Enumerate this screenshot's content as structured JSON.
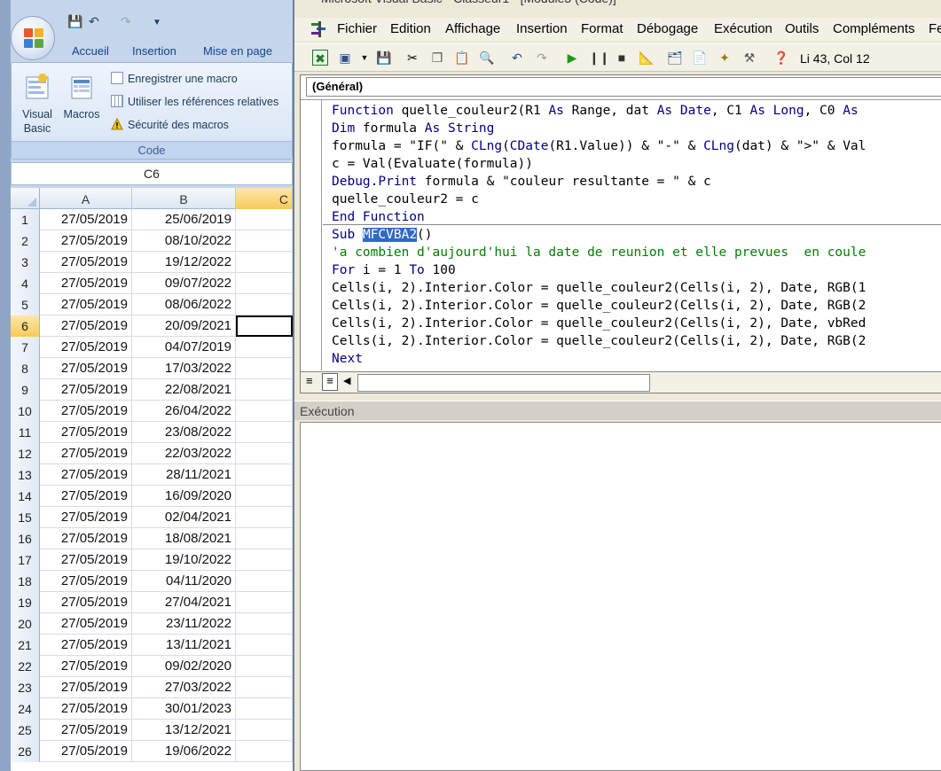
{
  "excel": {
    "ribbon_tabs": [
      "Accueil",
      "Insertion",
      "Mise en page"
    ],
    "ribbon_group": "Code",
    "big_buttons": [
      {
        "label": "Visual\nBasic",
        "icon": "visual-basic-icon"
      },
      {
        "label": "Macros",
        "icon": "macros-icon"
      }
    ],
    "small_buttons": [
      {
        "label": "Enregistrer une macro",
        "icon": "record-macro-icon"
      },
      {
        "label": "Utiliser les références relatives",
        "icon": "relative-references-icon"
      },
      {
        "label": "Sécurité des macros",
        "icon": "warning-icon"
      }
    ],
    "name_box": "C6",
    "columns": [
      "A",
      "B",
      "C"
    ],
    "selected_column": "C",
    "selected_row": 6,
    "rows": [
      {
        "n": "1",
        "a": "27/05/2019",
        "b": "25/06/2019"
      },
      {
        "n": "2",
        "a": "27/05/2019",
        "b": "08/10/2022"
      },
      {
        "n": "3",
        "a": "27/05/2019",
        "b": "19/12/2022"
      },
      {
        "n": "4",
        "a": "27/05/2019",
        "b": "09/07/2022"
      },
      {
        "n": "5",
        "a": "27/05/2019",
        "b": "08/06/2022"
      },
      {
        "n": "6",
        "a": "27/05/2019",
        "b": "20/09/2021"
      },
      {
        "n": "7",
        "a": "27/05/2019",
        "b": "04/07/2019"
      },
      {
        "n": "8",
        "a": "27/05/2019",
        "b": "17/03/2022"
      },
      {
        "n": "9",
        "a": "27/05/2019",
        "b": "22/08/2021"
      },
      {
        "n": "10",
        "a": "27/05/2019",
        "b": "26/04/2022"
      },
      {
        "n": "11",
        "a": "27/05/2019",
        "b": "23/08/2022"
      },
      {
        "n": "12",
        "a": "27/05/2019",
        "b": "22/03/2022"
      },
      {
        "n": "13",
        "a": "27/05/2019",
        "b": "28/11/2021"
      },
      {
        "n": "14",
        "a": "27/05/2019",
        "b": "16/09/2020"
      },
      {
        "n": "15",
        "a": "27/05/2019",
        "b": "02/04/2021"
      },
      {
        "n": "16",
        "a": "27/05/2019",
        "b": "18/08/2021"
      },
      {
        "n": "17",
        "a": "27/05/2019",
        "b": "19/10/2022"
      },
      {
        "n": "18",
        "a": "27/05/2019",
        "b": "04/11/2020"
      },
      {
        "n": "19",
        "a": "27/05/2019",
        "b": "27/04/2021"
      },
      {
        "n": "20",
        "a": "27/05/2019",
        "b": "23/11/2022"
      },
      {
        "n": "21",
        "a": "27/05/2019",
        "b": "13/11/2021"
      },
      {
        "n": "22",
        "a": "27/05/2019",
        "b": "09/02/2020"
      },
      {
        "n": "23",
        "a": "27/05/2019",
        "b": "27/03/2022"
      },
      {
        "n": "24",
        "a": "27/05/2019",
        "b": "30/01/2023"
      },
      {
        "n": "25",
        "a": "27/05/2019",
        "b": "13/12/2021"
      },
      {
        "n": "26",
        "a": "27/05/2019",
        "b": "19/06/2022"
      }
    ]
  },
  "vbe": {
    "title": "Microsoft Visual Basic - Classeur1 - [Module3 (Code)]",
    "menus": [
      "Fichier",
      "Edition",
      "Affichage",
      "Insertion",
      "Format",
      "Débogage",
      "Exécution",
      "Outils",
      "Compléments",
      "Fe"
    ],
    "cursor_position": "Li 43, Col 12",
    "procedure_combo": "(Général)",
    "immediate_title": "Exécution",
    "code_lines": [
      [
        {
          "t": "Function",
          "c": "kw"
        },
        {
          "t": " quelle_couleur2(R1 "
        },
        {
          "t": "As",
          "c": "kw"
        },
        {
          "t": " Range, dat "
        },
        {
          "t": "As",
          "c": "kw"
        },
        {
          "t": " "
        },
        {
          "t": "Date",
          "c": "kw"
        },
        {
          "t": ", C1 "
        },
        {
          "t": "As",
          "c": "kw"
        },
        {
          "t": " "
        },
        {
          "t": "Long",
          "c": "kw"
        },
        {
          "t": ", C0 "
        },
        {
          "t": "As",
          "c": "kw"
        }
      ],
      [
        {
          "t": "Dim",
          "c": "kw"
        },
        {
          "t": " formula "
        },
        {
          "t": "As",
          "c": "kw"
        },
        {
          "t": " "
        },
        {
          "t": "String",
          "c": "kw"
        }
      ],
      [
        {
          "t": "formula = \"IF(\" & "
        },
        {
          "t": "CLng",
          "c": "kw"
        },
        {
          "t": "("
        },
        {
          "t": "CDate",
          "c": "kw"
        },
        {
          "t": "(R1.Value)) & \"-\" & "
        },
        {
          "t": "CLng",
          "c": "kw"
        },
        {
          "t": "(dat) & \">\" & Val"
        }
      ],
      [
        {
          "t": "c = Val(Evaluate(formula))"
        }
      ],
      [
        {
          "t": "Debug",
          "c": "kw"
        },
        {
          "t": "."
        },
        {
          "t": "Print",
          "c": "kw"
        },
        {
          "t": " formula & \"couleur resultante = \" & c"
        }
      ],
      [
        {
          "t": "quelle_couleur2 = c"
        }
      ],
      [
        {
          "t": "End Function",
          "c": "kw"
        }
      ],
      [
        {
          "t": "Sub",
          "c": "kw"
        },
        {
          "t": " "
        },
        {
          "t": "MFCVBA2",
          "c": "hl"
        },
        {
          "t": "()"
        }
      ],
      [
        {
          "t": "'a combien d'aujourd'hui la date de reunion et elle prevues  en coule",
          "c": "cm"
        }
      ],
      [
        {
          "t": "For",
          "c": "kw"
        },
        {
          "t": " i = 1 "
        },
        {
          "t": "To",
          "c": "kw"
        },
        {
          "t": " 100"
        }
      ],
      [
        {
          "t": "Cells(i, 2).Interior.Color = quelle_couleur2(Cells(i, 2), Date, RGB(1"
        }
      ],
      [
        {
          "t": "Cells(i, 2).Interior.Color = quelle_couleur2(Cells(i, 2), Date, RGB(2"
        }
      ],
      [
        {
          "t": "Cells(i, 2).Interior.Color = quelle_couleur2(Cells(i, 2), Date, vbRed"
        }
      ],
      [
        {
          "t": "Cells(i, 2).Interior.Color = quelle_couleur2(Cells(i, 2), Date, RGB(2"
        }
      ],
      [
        {
          "t": "Next",
          "c": "kw"
        }
      ]
    ]
  },
  "colors": {
    "keyword": "#00007f",
    "comment": "#007f00",
    "selection": "#3169c6",
    "selected_header": "#f8c95a"
  }
}
